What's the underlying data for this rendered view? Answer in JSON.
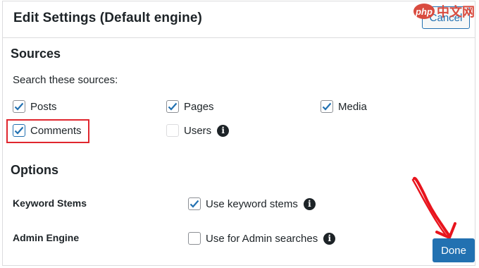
{
  "header": {
    "title": "Edit Settings (Default engine)",
    "cancel_label": "Cancel"
  },
  "watermark": {
    "logo": "php",
    "text": "中文网"
  },
  "sources": {
    "heading": "Sources",
    "instruction": "Search these sources:",
    "items": [
      {
        "label": "Posts",
        "checked": true
      },
      {
        "label": "Pages",
        "checked": true
      },
      {
        "label": "Media",
        "checked": true
      },
      {
        "label": "Comments",
        "checked": true
      },
      {
        "label": "Users",
        "checked": false
      }
    ]
  },
  "options": {
    "heading": "Options",
    "keyword_stems": {
      "label": "Keyword Stems",
      "checkbox_label": "Use keyword stems",
      "checked": true
    },
    "admin_engine": {
      "label": "Admin Engine",
      "checkbox_label": "Use for Admin searches",
      "checked": false
    }
  },
  "done_label": "Done",
  "colors": {
    "accent": "#2271b1",
    "highlight": "#e0262e",
    "arrow": "#e8141d"
  },
  "icons": [
    "checkmark-icon",
    "info-icon",
    "arrow-icon"
  ]
}
